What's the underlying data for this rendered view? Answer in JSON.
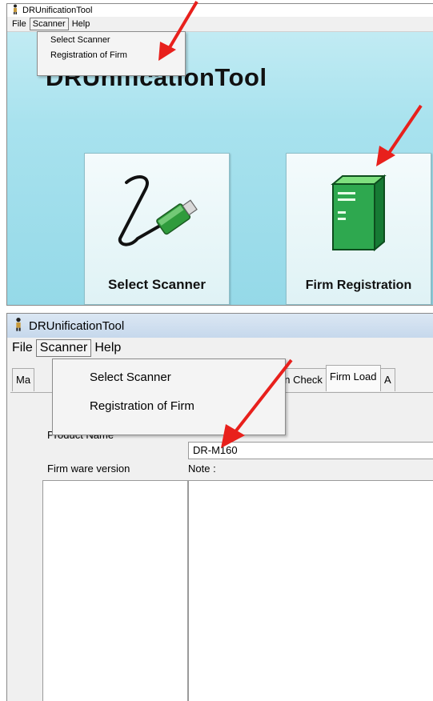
{
  "top": {
    "window_title": "DRUnificationTool",
    "menu": {
      "file": "File",
      "scanner": "Scanner",
      "help": "Help"
    },
    "dropdown": [
      "Select Scanner",
      "Registration of Firm"
    ],
    "hero_title": "DRUnificationTool",
    "buttons": {
      "select_scanner": "Select Scanner",
      "firm_registration": "Firm Registration"
    }
  },
  "bottom": {
    "window_title": "DRUnificationTool",
    "menu": {
      "file": "File",
      "scanner": "Scanner",
      "help": "Help"
    },
    "dropdown": [
      "Select Scanner",
      "Registration of Firm"
    ],
    "tabs": [
      "Ma",
      "an Check",
      "Firm Load",
      "A"
    ],
    "product_name_label": "Product Name",
    "product_name_value": "DR-M160",
    "firmware_version_label": "Firm ware version",
    "note_label": "Note :"
  },
  "colors": {
    "arrow": "#e8201c",
    "top_background": "#a8e2ee",
    "firm_book": "#2ea84f"
  },
  "icons": [
    "app-person-icon",
    "scanner-cable-icon",
    "firm-book-icon",
    "red-pointer-arrow"
  ]
}
